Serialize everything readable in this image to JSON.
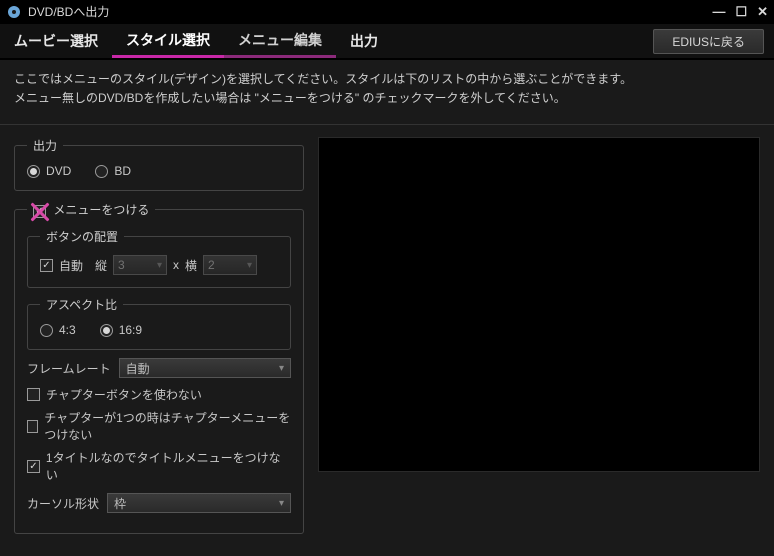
{
  "window": {
    "title": "DVD/BDへ出力",
    "return_button": "EDIUSに戻る"
  },
  "tabs": {
    "movie": "ムービー選択",
    "style": "スタイル選択",
    "menu_edit": "メニュー編集",
    "output": "出力"
  },
  "description": {
    "line1": "ここではメニューのスタイル(デザイン)を選択してください。スタイルは下のリストの中から選ぶことができます。",
    "line2": "メニュー無しのDVD/BDを作成したい場合は \"メニューをつける\" のチェックマークを外してください。"
  },
  "output_group": {
    "legend": "出力",
    "dvd": "DVD",
    "bd": "BD"
  },
  "menu_group": {
    "checkbox_label": "メニューをつける",
    "button_layout": {
      "legend": "ボタンの配置",
      "auto": "自動",
      "vertical_label": "縦",
      "vertical_value": "3",
      "x": "x",
      "horizontal_label": "横",
      "horizontal_value": "2"
    },
    "aspect": {
      "legend": "アスペクト比",
      "r43": "4:3",
      "r169": "16:9"
    },
    "framerate_label": "フレームレート",
    "framerate_value": "自動",
    "chk_chapter_button": "チャプターボタンを使わない",
    "chk_one_chapter": "チャプターが1つの時はチャプターメニューをつけない",
    "chk_one_title": "1タイトルなのでタイトルメニューをつけない",
    "cursor_label": "カーソル形状",
    "cursor_value": "枠"
  }
}
